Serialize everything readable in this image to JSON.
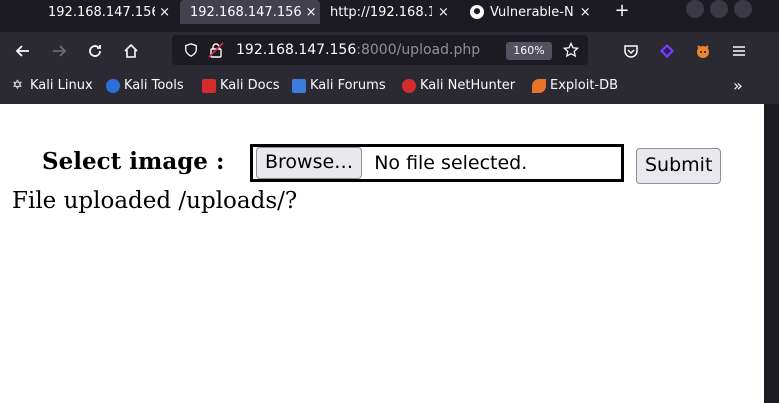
{
  "tabs": [
    {
      "title": "192.168.147.156",
      "close": "×"
    },
    {
      "title": "192.168.147.156",
      "close": "×",
      "active": true
    },
    {
      "title": "http://192.168.14",
      "close": "×"
    },
    {
      "title": "Vulnerable-N",
      "close": "×",
      "icon": "github-icon"
    }
  ],
  "new_tab": "+",
  "nav": {
    "url_host": "192.168.147.156",
    "url_rest": ":8000/upload.php",
    "zoom": "160%"
  },
  "bookmarks": [
    {
      "label": "Kali Linux",
      "icon_color": "#ffffff"
    },
    {
      "label": "Kali Tools",
      "icon_color": "#2d6fd7"
    },
    {
      "label": "Kali Docs",
      "icon_color": "#d42c2c"
    },
    {
      "label": "Kali Forums",
      "icon_color": "#3b7ddd"
    },
    {
      "label": "Kali NetHunter",
      "icon_color": "#d42c2c"
    },
    {
      "label": "Exploit-DB",
      "icon_color": "#e8742a"
    }
  ],
  "bookmarks_more": "»",
  "page": {
    "label": "Select image :",
    "browse_label": "Browse…",
    "file_status": "No file selected.",
    "submit_label": "Submit",
    "message": "File uploaded /uploads/?"
  }
}
